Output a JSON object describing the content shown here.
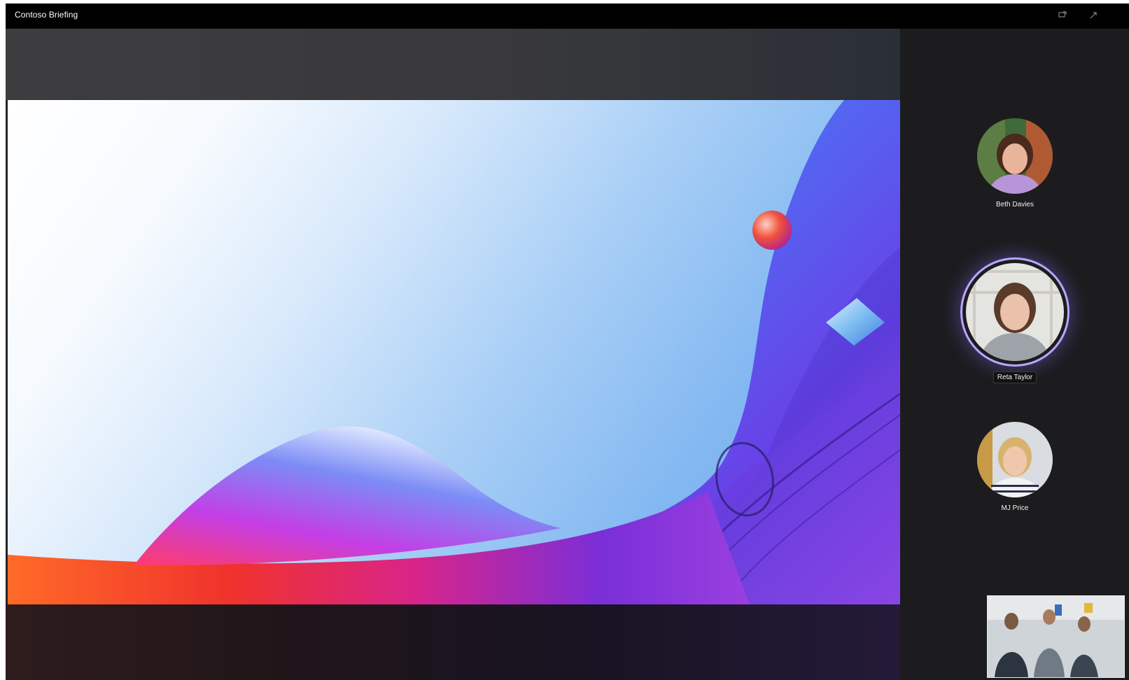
{
  "app": {
    "title": "Contoso Briefing"
  },
  "titlebar": {
    "icons": [
      "share-screen-icon",
      "expand-icon"
    ]
  },
  "participants": [
    {
      "name": "Beth Davies",
      "speaking": false
    },
    {
      "name": "Reta Taylor",
      "speaking": true
    },
    {
      "name": "MJ Price",
      "speaking": false
    }
  ],
  "colors": {
    "titlebar": "#000000",
    "rail": "#1c1c1e",
    "active_ring": "#b7a6ff"
  }
}
